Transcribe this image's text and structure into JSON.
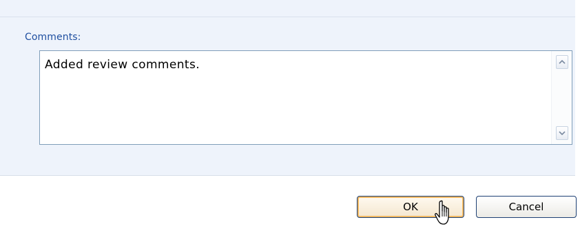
{
  "comments": {
    "label": "Comments:",
    "value": "Added review comments."
  },
  "buttons": {
    "ok_label": "OK",
    "cancel_label": "Cancel"
  },
  "icons": {
    "scroll_up": "chevron-up-icon",
    "scroll_down": "chevron-down-icon",
    "cursor": "hand-pointer-cursor-icon"
  },
  "colors": {
    "panel_bg": "#eef3fb",
    "label": "#1f4fa0",
    "field_border": "#7f9db9",
    "ok_focus": "#f1b862",
    "button_border": "#1c3f73"
  }
}
